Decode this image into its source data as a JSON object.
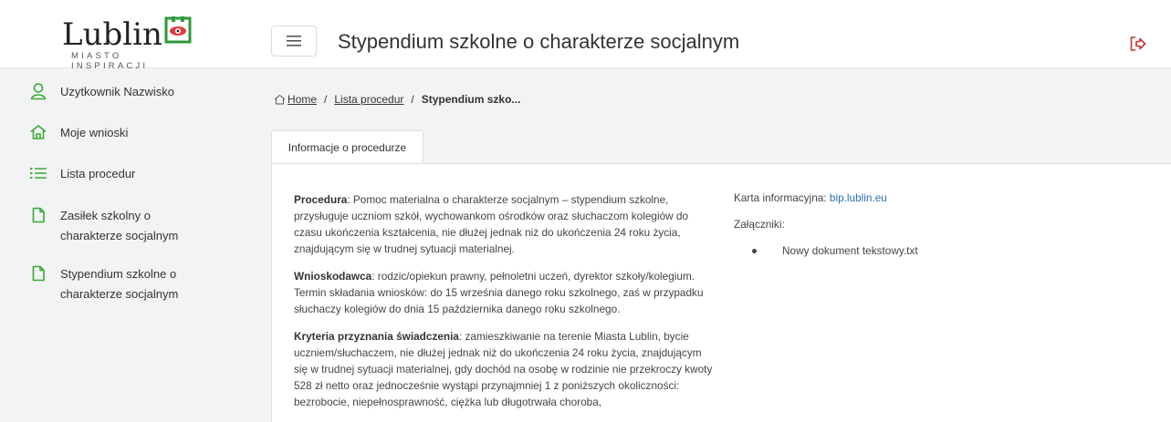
{
  "logo": {
    "word": "Lublin",
    "subtitle": "MIASTO INSPIRACJI"
  },
  "header": {
    "title": "Stypendium szkolne o charakterze socjalnym"
  },
  "sidebar": {
    "items": [
      {
        "label": "Uzytkownik Nazwisko",
        "icon": "user-icon"
      },
      {
        "label": "Moje wnioski",
        "icon": "home-icon"
      },
      {
        "label": "Lista procedur",
        "icon": "list-icon"
      },
      {
        "label": "Zasiłek szkolny o charakterze socjalnym",
        "icon": "document-icon"
      },
      {
        "label": "Stypendium szkolne o charakterze socjalnym",
        "icon": "document-icon"
      }
    ]
  },
  "breadcrumb": {
    "home": "Home",
    "list": "Lista procedur",
    "current": "Stypendium szko..."
  },
  "tab": {
    "label": "Informacje o procedurze"
  },
  "content": {
    "procedura_label": "Procedura",
    "procedura_text": ": Pomoc materialna o charakterze socjalnym – stypendium szkolne, przysługuje uczniom szkół, wychowankom ośrodków oraz słuchaczom kolegiów do czasu ukończenia kształcenia, nie dłużej jednak niż do ukończenia 24 roku życia, znajdującym się w trudnej sytuacji materialnej.",
    "wnioskodawca_label": "Wnioskodawca",
    "wnioskodawca_text": ": rodzic/opiekun prawny, pełnoletni uczeń, dyrektor szkoły/kolegium. Termin składania wniosków: do 15 września danego roku szkolnego, zaś w przypadku słuchaczy kolegiów do dnia 15 października danego roku szkolnego.",
    "kryteria_label": "Kryteria przyznania świadczenia",
    "kryteria_text": ": zamieszkiwanie na terenie Miasta Lublin, bycie uczniem/słuchaczem, nie dłużej jednak niż do ukończenia 24 roku życia, znajdującym się w trudnej sytuacji materialnej, gdy dochód na osobę w rodzinie nie przekroczy kwoty 528 zł netto oraz jednocześnie wystąpi przynajmniej 1 z poniższych okoliczności: bezrobocie, niepełnosprawność, ciężka lub długotrwała choroba,",
    "karta_label": "Karta informacyjna: ",
    "karta_link": "bip.lublin.eu",
    "zalaczniki_label": "Załączniki:",
    "attachments": [
      "Nowy dokument tekstowy.txt"
    ]
  },
  "colors": {
    "accent_green": "#3aa935",
    "link_blue": "#2c6fb7",
    "logout_red": "#c0392b"
  }
}
